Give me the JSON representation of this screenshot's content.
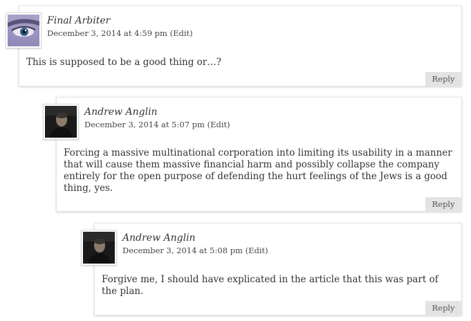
{
  "comments": [
    {
      "author": "Final Arbiter",
      "date": "December 3, 2014 at 4:59 pm",
      "edit_label": "(Edit)",
      "text": "This is supposed to be a good thing or…?",
      "reply_label": "Reply",
      "avatar_icon": "eye-closeup-avatar"
    },
    {
      "author": "Andrew Anglin",
      "date": "December 3, 2014 at 5:07 pm",
      "edit_label": "(Edit)",
      "text": "Forcing a massive multinational corporation into limiting its usability in a manner that will cause them massive financial harm and possibly collapse the company entirely for the open purpose of defending the hurt feelings of the Jews is a good thing, yes.",
      "reply_label": "Reply",
      "avatar_icon": "person-photo-avatar"
    },
    {
      "author": "Andrew Anglin",
      "date": "December 3, 2014 at 5:08 pm",
      "edit_label": "(Edit)",
      "text": "Forgive me, I should have explicated in the article that this was part of the plan.",
      "reply_label": "Reply",
      "avatar_icon": "person-photo-avatar"
    }
  ],
  "colors": {
    "reply_bg": "#e3e3e3",
    "text": "#333333"
  }
}
